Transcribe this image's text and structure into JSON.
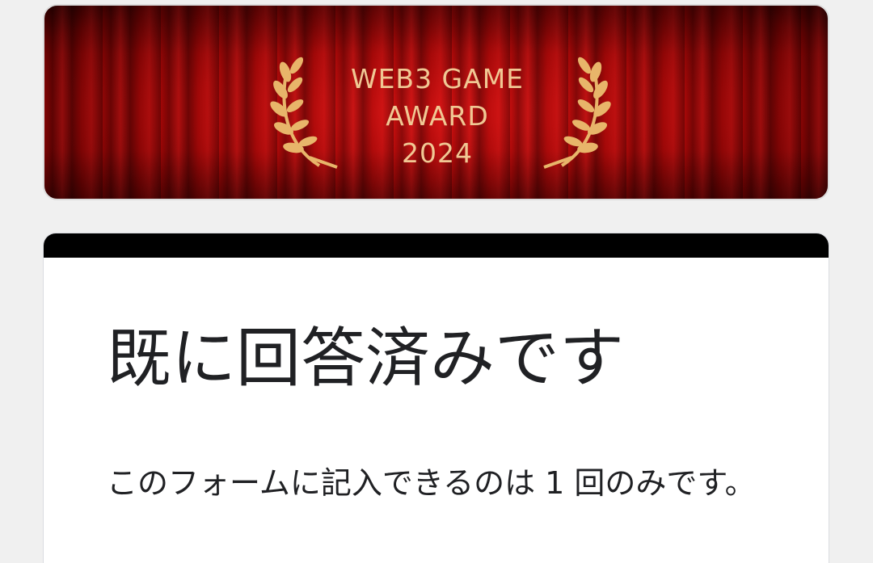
{
  "banner": {
    "title_lines": [
      "WEB3 GAME",
      "AWARD",
      "2024"
    ],
    "text_color": "#f0c894",
    "curtain_color": "#b00a0a"
  },
  "card": {
    "accent_color": "#000000",
    "heading": "既に回答済みです",
    "message": "このフォームに記入できるのは 1 回のみです。"
  }
}
